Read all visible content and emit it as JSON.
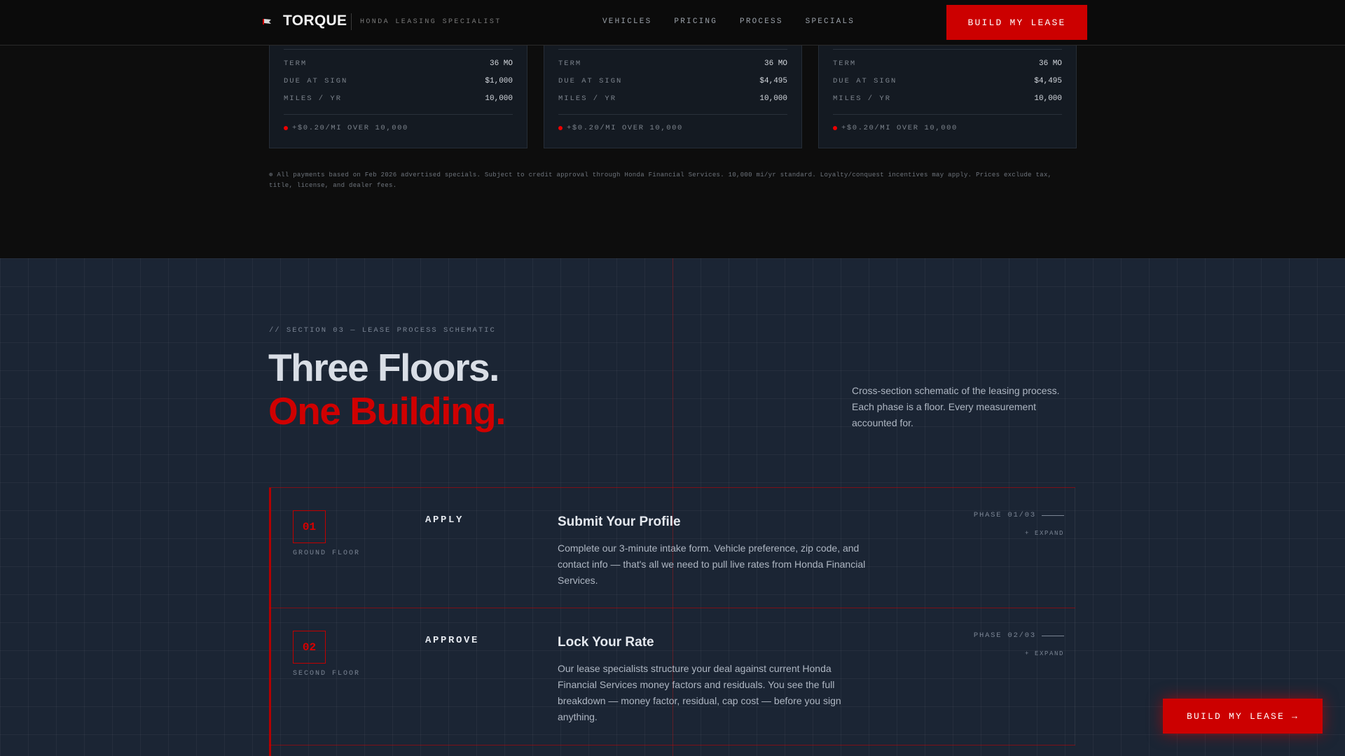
{
  "header": {
    "logo": "TORQUE",
    "tagline": "HONDA LEASING SPECIALIST",
    "nav": [
      "VEHICLES",
      "PRICING",
      "PROCESS",
      "SPECIALS"
    ],
    "cta": "BUILD MY LEASE"
  },
  "cards": [
    {
      "rows": [
        {
          "label": "TERM",
          "value": "36 MO"
        },
        {
          "label": "DUE AT SIGN",
          "value": "$1,000"
        },
        {
          "label": "MILES / YR",
          "value": "10,000"
        }
      ],
      "note": "+$0.20/MI OVER 10,000"
    },
    {
      "rows": [
        {
          "label": "TERM",
          "value": "36 MO"
        },
        {
          "label": "DUE AT SIGN",
          "value": "$4,495"
        },
        {
          "label": "MILES / YR",
          "value": "10,000"
        }
      ],
      "note": "+$0.20/MI OVER 10,000"
    },
    {
      "rows": [
        {
          "label": "TERM",
          "value": "36 MO"
        },
        {
          "label": "DUE AT SIGN",
          "value": "$4,495"
        },
        {
          "label": "MILES / YR",
          "value": "10,000"
        }
      ],
      "note": "+$0.20/MI OVER 10,000"
    }
  ],
  "disclaimer": "⊕ All payments based on Feb 2026 advertised specials. Subject to credit approval through Honda Financial Services. 10,000 mi/yr standard. Loyalty/conquest incentives may apply. Prices exclude tax, title, license, and dealer fees.",
  "process": {
    "section_label": "// SECTION 03 — LEASE PROCESS SCHEMATIC",
    "headline_line1": "Three Floors.",
    "headline_line2": "One Building.",
    "intro": "Cross-section schematic of the leasing process. Each phase is a floor. Every measurement accounted for.",
    "steps": [
      {
        "number": "01",
        "floor": "GROUND FLOOR",
        "label": "APPLY",
        "title": "Submit Your Profile",
        "description": "Complete our 3-minute intake form. Vehicle preference, zip code, and contact info — that's all we need to pull live rates from Honda Financial Services.",
        "phase": "PHASE 01/03",
        "expand": "+ EXPAND"
      },
      {
        "number": "02",
        "floor": "SECOND FLOOR",
        "label": "APPROVE",
        "title": "Lock Your Rate",
        "description": "Our lease specialists structure your deal against current Honda Financial Services money factors and residuals. You see the full breakdown — money factor, residual, cap cost — before you sign anything.",
        "phase": "PHASE 02/03",
        "expand": "+ EXPAND"
      }
    ]
  },
  "floating_cta": {
    "label": "BUILD MY LEASE",
    "arrow": "→"
  },
  "colors": {
    "accent": "#cc0000",
    "header_bg": "#0b0b0b",
    "section_bg": "#1b2534"
  }
}
